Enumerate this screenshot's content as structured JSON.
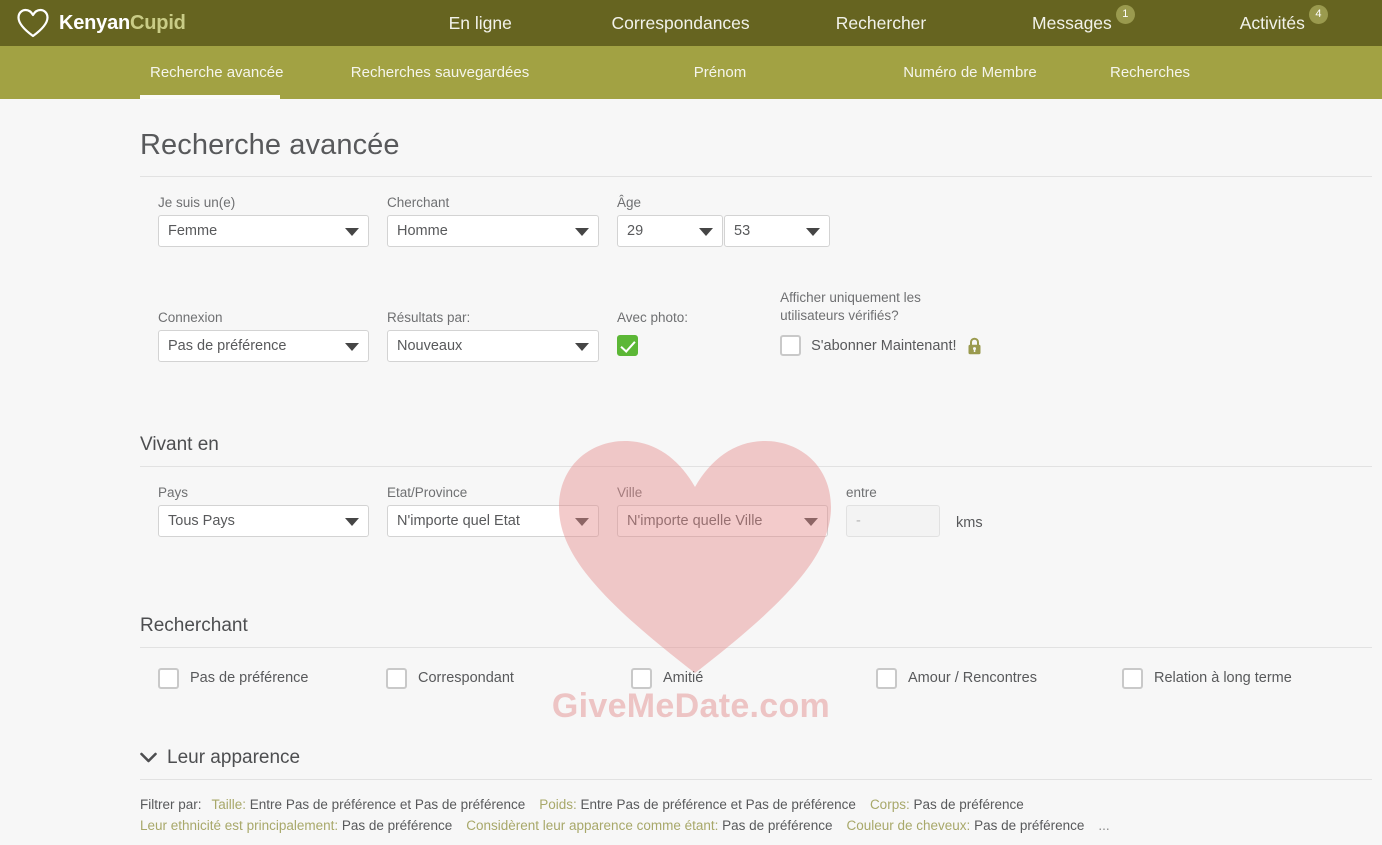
{
  "brand": {
    "part1": "Kenyan",
    "part2": "Cupid",
    "logo_icon": "heart-outline-icon"
  },
  "topnav": [
    {
      "label": "En ligne",
      "badge": null
    },
    {
      "label": "Correspondances",
      "badge": null
    },
    {
      "label": "Rechercher",
      "badge": null
    },
    {
      "label": "Messages",
      "badge": "1"
    },
    {
      "label": "Activités",
      "badge": "4"
    }
  ],
  "subnav": {
    "tabs": [
      {
        "label": "Recherche avancée",
        "active": true
      },
      {
        "label": "Recherches sauvegardées",
        "active": false
      },
      {
        "label": "Prénom",
        "active": false
      },
      {
        "label": "Numéro de Membre",
        "active": false
      },
      {
        "label": "Recherches",
        "active": false
      }
    ]
  },
  "page": {
    "title": "Recherche avancée"
  },
  "basic": {
    "gender": {
      "label": "Je suis un(e)",
      "value": "Femme"
    },
    "seeking": {
      "label": "Cherchant",
      "value": "Homme"
    },
    "age": {
      "label": "Âge",
      "min": "29",
      "max": "53"
    },
    "connection": {
      "label": "Connexion",
      "value": "Pas de préférence"
    },
    "results_by": {
      "label": "Résultats par:",
      "value": "Nouveaux"
    },
    "with_photo": {
      "label": "Avec photo:",
      "checked": true
    },
    "verified": {
      "label_line1": "Afficher uniquement les",
      "label_line2": "utilisateurs vérifiés?",
      "checkbox_label": "S'abonner Maintenant!",
      "checked": false,
      "lock_icon": "lock-icon"
    }
  },
  "location": {
    "section_title": "Vivant en",
    "country": {
      "label": "Pays",
      "value": "Tous Pays"
    },
    "state": {
      "label": "Etat/Province",
      "value": "N'importe quel Etat"
    },
    "city": {
      "label": "Ville",
      "value": "N'importe quelle Ville"
    },
    "distance": {
      "label": "entre",
      "value": "-",
      "unit": "kms",
      "disabled": true
    }
  },
  "seeking_section": {
    "section_title": "Recherchant",
    "options": [
      {
        "label": "Pas de préférence",
        "checked": false
      },
      {
        "label": "Correspondant",
        "checked": false
      },
      {
        "label": "Amitié",
        "checked": false
      },
      {
        "label": "Amour / Rencontres",
        "checked": false
      },
      {
        "label": "Relation à long terme",
        "checked": false
      }
    ]
  },
  "appearance": {
    "section_title": "Leur apparence",
    "chevron_icon": "chevron-down-icon",
    "filter_lead": "Filtrer par:",
    "items_line1": [
      {
        "key": "Taille:",
        "value": "Entre Pas de préférence et Pas de préférence"
      },
      {
        "key": "Poids:",
        "value": "Entre Pas de préférence et Pas de préférence"
      },
      {
        "key": "Corps:",
        "value": "Pas de préférence"
      }
    ],
    "items_line2": [
      {
        "key": "Leur ethnicité est principalement:",
        "value": "Pas de préférence"
      },
      {
        "key": "Considèrent leur apparence comme étant:",
        "value": "Pas de préférence"
      },
      {
        "key": "Couleur de cheveux:",
        "value": "Pas de préférence"
      }
    ],
    "ellipsis": "..."
  },
  "watermark": {
    "text": "GiveMeDate.com",
    "heart_icon": "heart-watermark-icon"
  },
  "colors": {
    "topbar": "#666420",
    "subbar": "#a2a243",
    "brand_accent": "#c9cc86",
    "checkbox_green": "#5cb736",
    "filter_key": "#a8a86a",
    "watermark_pink": "#e49696"
  }
}
